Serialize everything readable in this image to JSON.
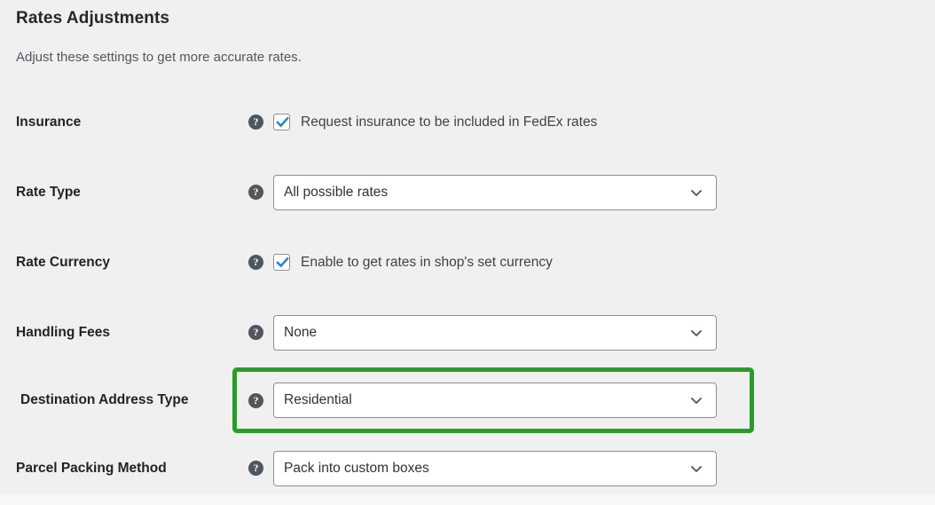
{
  "section": {
    "title": "Rates Adjustments",
    "description": "Adjust these settings to get more accurate rates."
  },
  "icons": {
    "help": "?",
    "chevron_down": "chevron-down-icon",
    "checkmark": "check-icon"
  },
  "colors": {
    "page_background": "#f0f0f0",
    "highlight_border": "#2a9c2a",
    "checkbox_check": "#3582c4",
    "label_text": "#1d2327",
    "field_border": "#8c8f94"
  },
  "rows": [
    {
      "label": "Insurance",
      "type": "checkbox",
      "checked": true,
      "checkbox_label": "Request insurance to be included in FedEx rates",
      "highlighted": false
    },
    {
      "label": "Rate Type",
      "type": "select",
      "value": "All possible rates",
      "highlighted": false
    },
    {
      "label": "Rate Currency",
      "type": "checkbox",
      "checked": true,
      "checkbox_label": "Enable to get rates in shop's set currency",
      "highlighted": false
    },
    {
      "label": "Handling Fees",
      "type": "select",
      "value": "None",
      "highlighted": false
    },
    {
      "label": "Destination Address Type",
      "type": "select",
      "value": "Residential",
      "highlighted": true
    },
    {
      "label": "Parcel Packing Method",
      "type": "select",
      "value": "Pack into custom boxes",
      "highlighted": false
    }
  ]
}
